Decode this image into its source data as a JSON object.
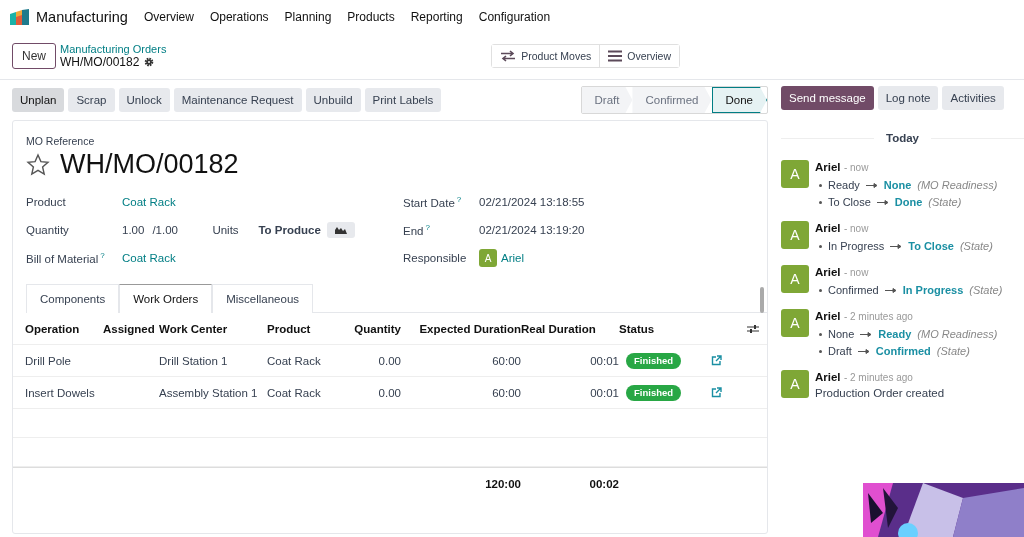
{
  "navbar": {
    "app": "Manufacturing",
    "menus": [
      "Overview",
      "Operations",
      "Planning",
      "Products",
      "Reporting",
      "Configuration"
    ]
  },
  "control_panel": {
    "new_button": "New",
    "breadcrumb": "Manufacturing Orders",
    "record": "WH/MO/00182",
    "smart_buttons": [
      {
        "label": "Product Moves",
        "kind": "moves"
      },
      {
        "label": "Overview",
        "kind": "list"
      }
    ]
  },
  "actions": [
    "Unplan",
    "Scrap",
    "Unlock",
    "Maintenance Request",
    "Unbuild",
    "Print Labels"
  ],
  "status_steps": [
    {
      "label": "Draft",
      "selected": false
    },
    {
      "label": "Confirmed",
      "selected": false
    },
    {
      "label": "Done",
      "selected": true
    }
  ],
  "form": {
    "reference_label": "MO Reference",
    "reference": "WH/MO/00182",
    "starred": false,
    "left_fields": [
      {
        "label": "Product",
        "kind": "link",
        "value": "Coat Rack"
      },
      {
        "label": "Quantity",
        "kind": "quantity",
        "value": "1.00",
        "total": "/1.00",
        "uom": "Units",
        "producing": "To Produce"
      },
      {
        "label": "Bill of Material",
        "kind": "link",
        "value": "Coat Rack",
        "help": "?"
      }
    ],
    "right_fields": [
      {
        "label": "Start Date",
        "kind": "text",
        "value": "02/21/2024 13:18:55",
        "help": "?"
      },
      {
        "label": "End",
        "kind": "text",
        "value": "02/21/2024 13:19:20",
        "help": "?"
      },
      {
        "label": "Responsible",
        "kind": "user",
        "avatar": "A",
        "value": "Ariel"
      }
    ],
    "tabs": [
      {
        "label": "Components",
        "selected": false
      },
      {
        "label": "Work Orders",
        "selected": true
      },
      {
        "label": "Miscellaneous",
        "selected": false
      }
    ],
    "table": {
      "columns": [
        "Operation",
        "Assigned",
        "Work Center",
        "Product",
        "Quantity",
        "Expected Duration",
        "Real Duration",
        "Status"
      ],
      "rows": [
        {
          "operation": "Drill Pole",
          "work_center": "Drill Station 1",
          "product": "Coat Rack",
          "quantity": "0.00",
          "expected": "60:00",
          "real": "00:01",
          "status": "Finished"
        },
        {
          "operation": "Insert Dowels",
          "work_center": "Assembly Station 1",
          "product": "Coat Rack",
          "quantity": "0.00",
          "expected": "60:00",
          "real": "00:01",
          "status": "Finished"
        }
      ],
      "totals": {
        "expected": "120:00",
        "real": "00:02"
      }
    }
  },
  "chatter": {
    "buttons": [
      {
        "label": "Send message",
        "selected": true
      },
      {
        "label": "Log note",
        "selected": false
      },
      {
        "label": "Activities",
        "selected": false
      }
    ],
    "date_separator": "Today",
    "messages": [
      {
        "kind": "tracking",
        "avatar": "A",
        "author": "Ariel",
        "time": "- now",
        "changes": [
          {
            "from": "Ready",
            "to": "None",
            "field": "(MO Readiness)"
          },
          {
            "from": "To Close",
            "to": "Done",
            "field": "(State)"
          }
        ]
      },
      {
        "kind": "tracking",
        "avatar": "A",
        "author": "Ariel",
        "time": "- now",
        "changes": [
          {
            "from": "In Progress",
            "to": "To Close",
            "field": "(State)"
          }
        ]
      },
      {
        "kind": "tracking",
        "avatar": "A",
        "author": "Ariel",
        "time": "- now",
        "changes": [
          {
            "from": "Confirmed",
            "to": "In Progress",
            "field": "(State)"
          }
        ]
      },
      {
        "kind": "tracking",
        "avatar": "A",
        "author": "Ariel",
        "time": "- 2 minutes ago",
        "changes": [
          {
            "from": "None",
            "to": "Ready",
            "field": "(MO Readiness)"
          },
          {
            "from": "Draft",
            "to": "Confirmed",
            "field": "(State)"
          }
        ]
      },
      {
        "kind": "note",
        "avatar": "A",
        "author": "Ariel",
        "time": "- 2 minutes ago",
        "body": "Production Order created"
      }
    ]
  }
}
